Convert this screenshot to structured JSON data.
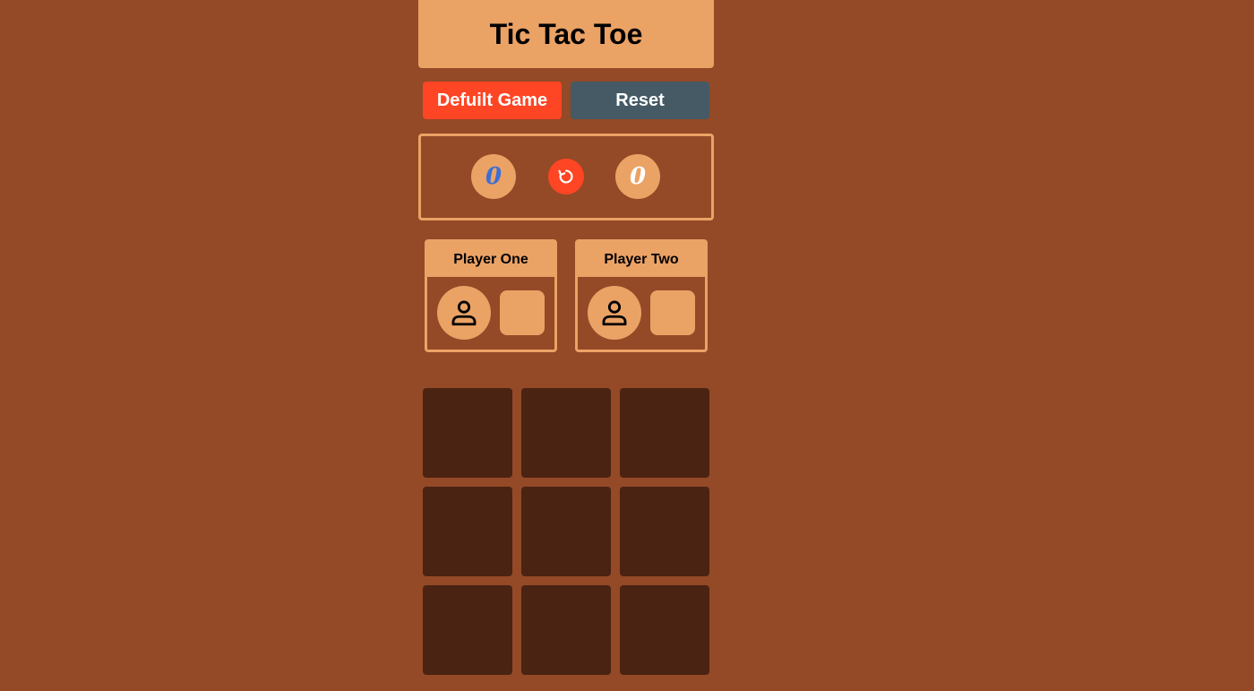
{
  "title": "Tic Tac Toe",
  "buttons": {
    "default_game": "Defuilt Game",
    "reset": "Reset"
  },
  "score": {
    "player_one": "0",
    "player_two": "0",
    "restart_icon": "restart-icon"
  },
  "players": [
    {
      "name": "Player One",
      "avatar_icon": "user-icon",
      "mark": ""
    },
    {
      "name": "Player Two",
      "avatar_icon": "user-icon",
      "mark": ""
    }
  ],
  "board": [
    "",
    "",
    "",
    "",
    "",
    "",
    "",
    "",
    ""
  ],
  "colors": {
    "background": "#944927",
    "accent": "#eba265",
    "danger": "#fe4524",
    "slate": "#455a64",
    "cell": "#4a2312",
    "score_one": "#3a6fd6",
    "score_two": "#ffffff"
  }
}
